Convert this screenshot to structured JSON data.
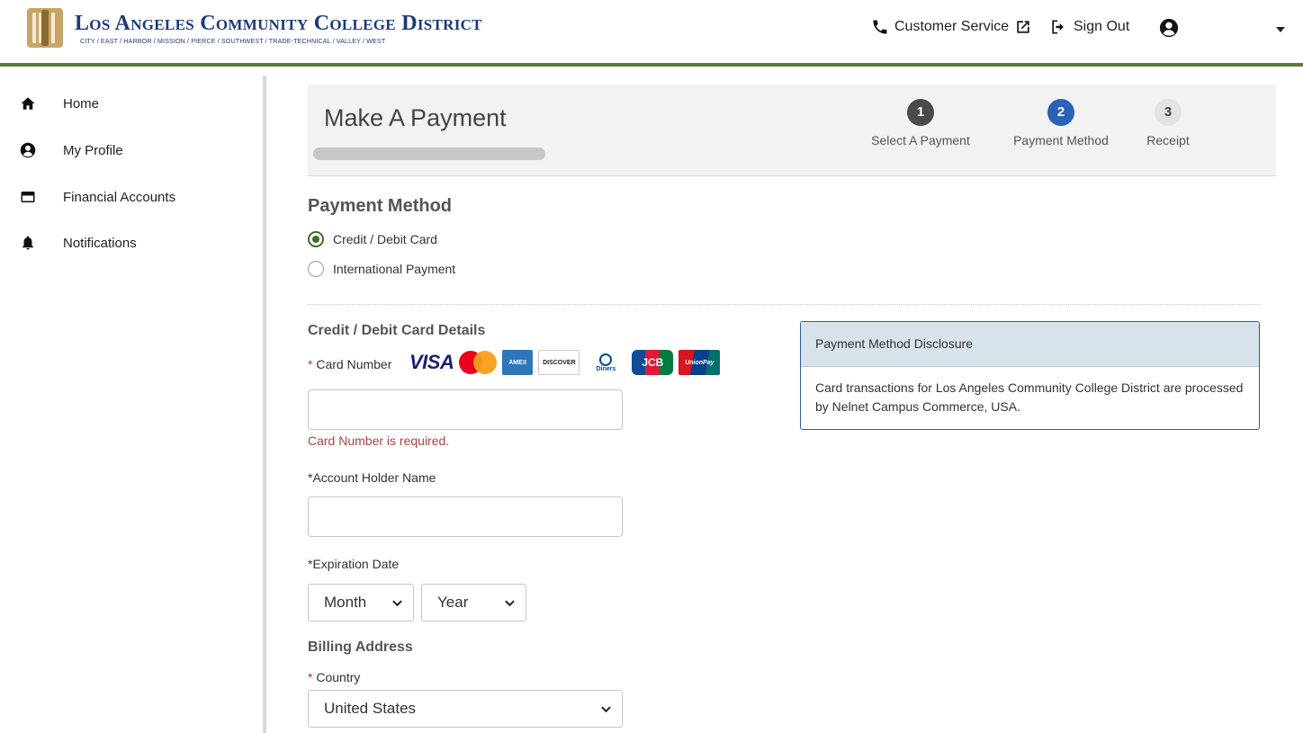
{
  "header": {
    "logo_title": "Los Angeles Community College District",
    "logo_subtitle": "CITY / EAST / HARBOR / MISSION / PIERCE / SOUTHWEST / TRADE-TECHNICAL / VALLEY / WEST",
    "customer_service": "Customer Service",
    "sign_out": "Sign Out"
  },
  "sidebar": {
    "items": [
      {
        "label": "Home",
        "icon": "home-icon"
      },
      {
        "label": "My Profile",
        "icon": "user-circle-icon"
      },
      {
        "label": "Financial Accounts",
        "icon": "credit-card-icon"
      },
      {
        "label": "Notifications",
        "icon": "bell-icon"
      }
    ]
  },
  "banner": {
    "title": "Make A Payment",
    "steps": [
      {
        "number": "1",
        "label": "Select A Payment",
        "state": "completed"
      },
      {
        "number": "2",
        "label": "Payment Method",
        "state": "current"
      },
      {
        "number": "3",
        "label": "Receipt",
        "state": "upcoming"
      }
    ]
  },
  "payment_method": {
    "title": "Payment Method",
    "options": [
      {
        "label": "Credit / Debit Card",
        "selected": true
      },
      {
        "label": "International Payment",
        "selected": false
      }
    ]
  },
  "card_details": {
    "title": "Credit / Debit Card Details",
    "card_number_label": "Card Number",
    "required_mark": "* ",
    "card_brands": [
      "VISA",
      "Mastercard",
      "American Express",
      "Discover",
      "Diners Club",
      "JCB",
      "UnionPay"
    ],
    "card_number_error": "Card Number is required.",
    "account_holder_label": "*Account Holder Name",
    "expiration_label": "*Expiration Date",
    "month_selected": "Month",
    "year_selected": "Year"
  },
  "billing": {
    "title": "Billing Address",
    "country_label": "Country",
    "country_selected": "United States"
  },
  "disclosure": {
    "title": "Payment Method Disclosure",
    "body": "Card transactions for Los Angeles Community College District are processed by Nelnet Campus Commerce, USA."
  },
  "colors": {
    "accent_green": "#5b7a3c",
    "step_current": "#2a62b6",
    "step_done": "#4a4a4a",
    "error_red": "#a94442",
    "disclosure_border": "#2a5d9f"
  }
}
